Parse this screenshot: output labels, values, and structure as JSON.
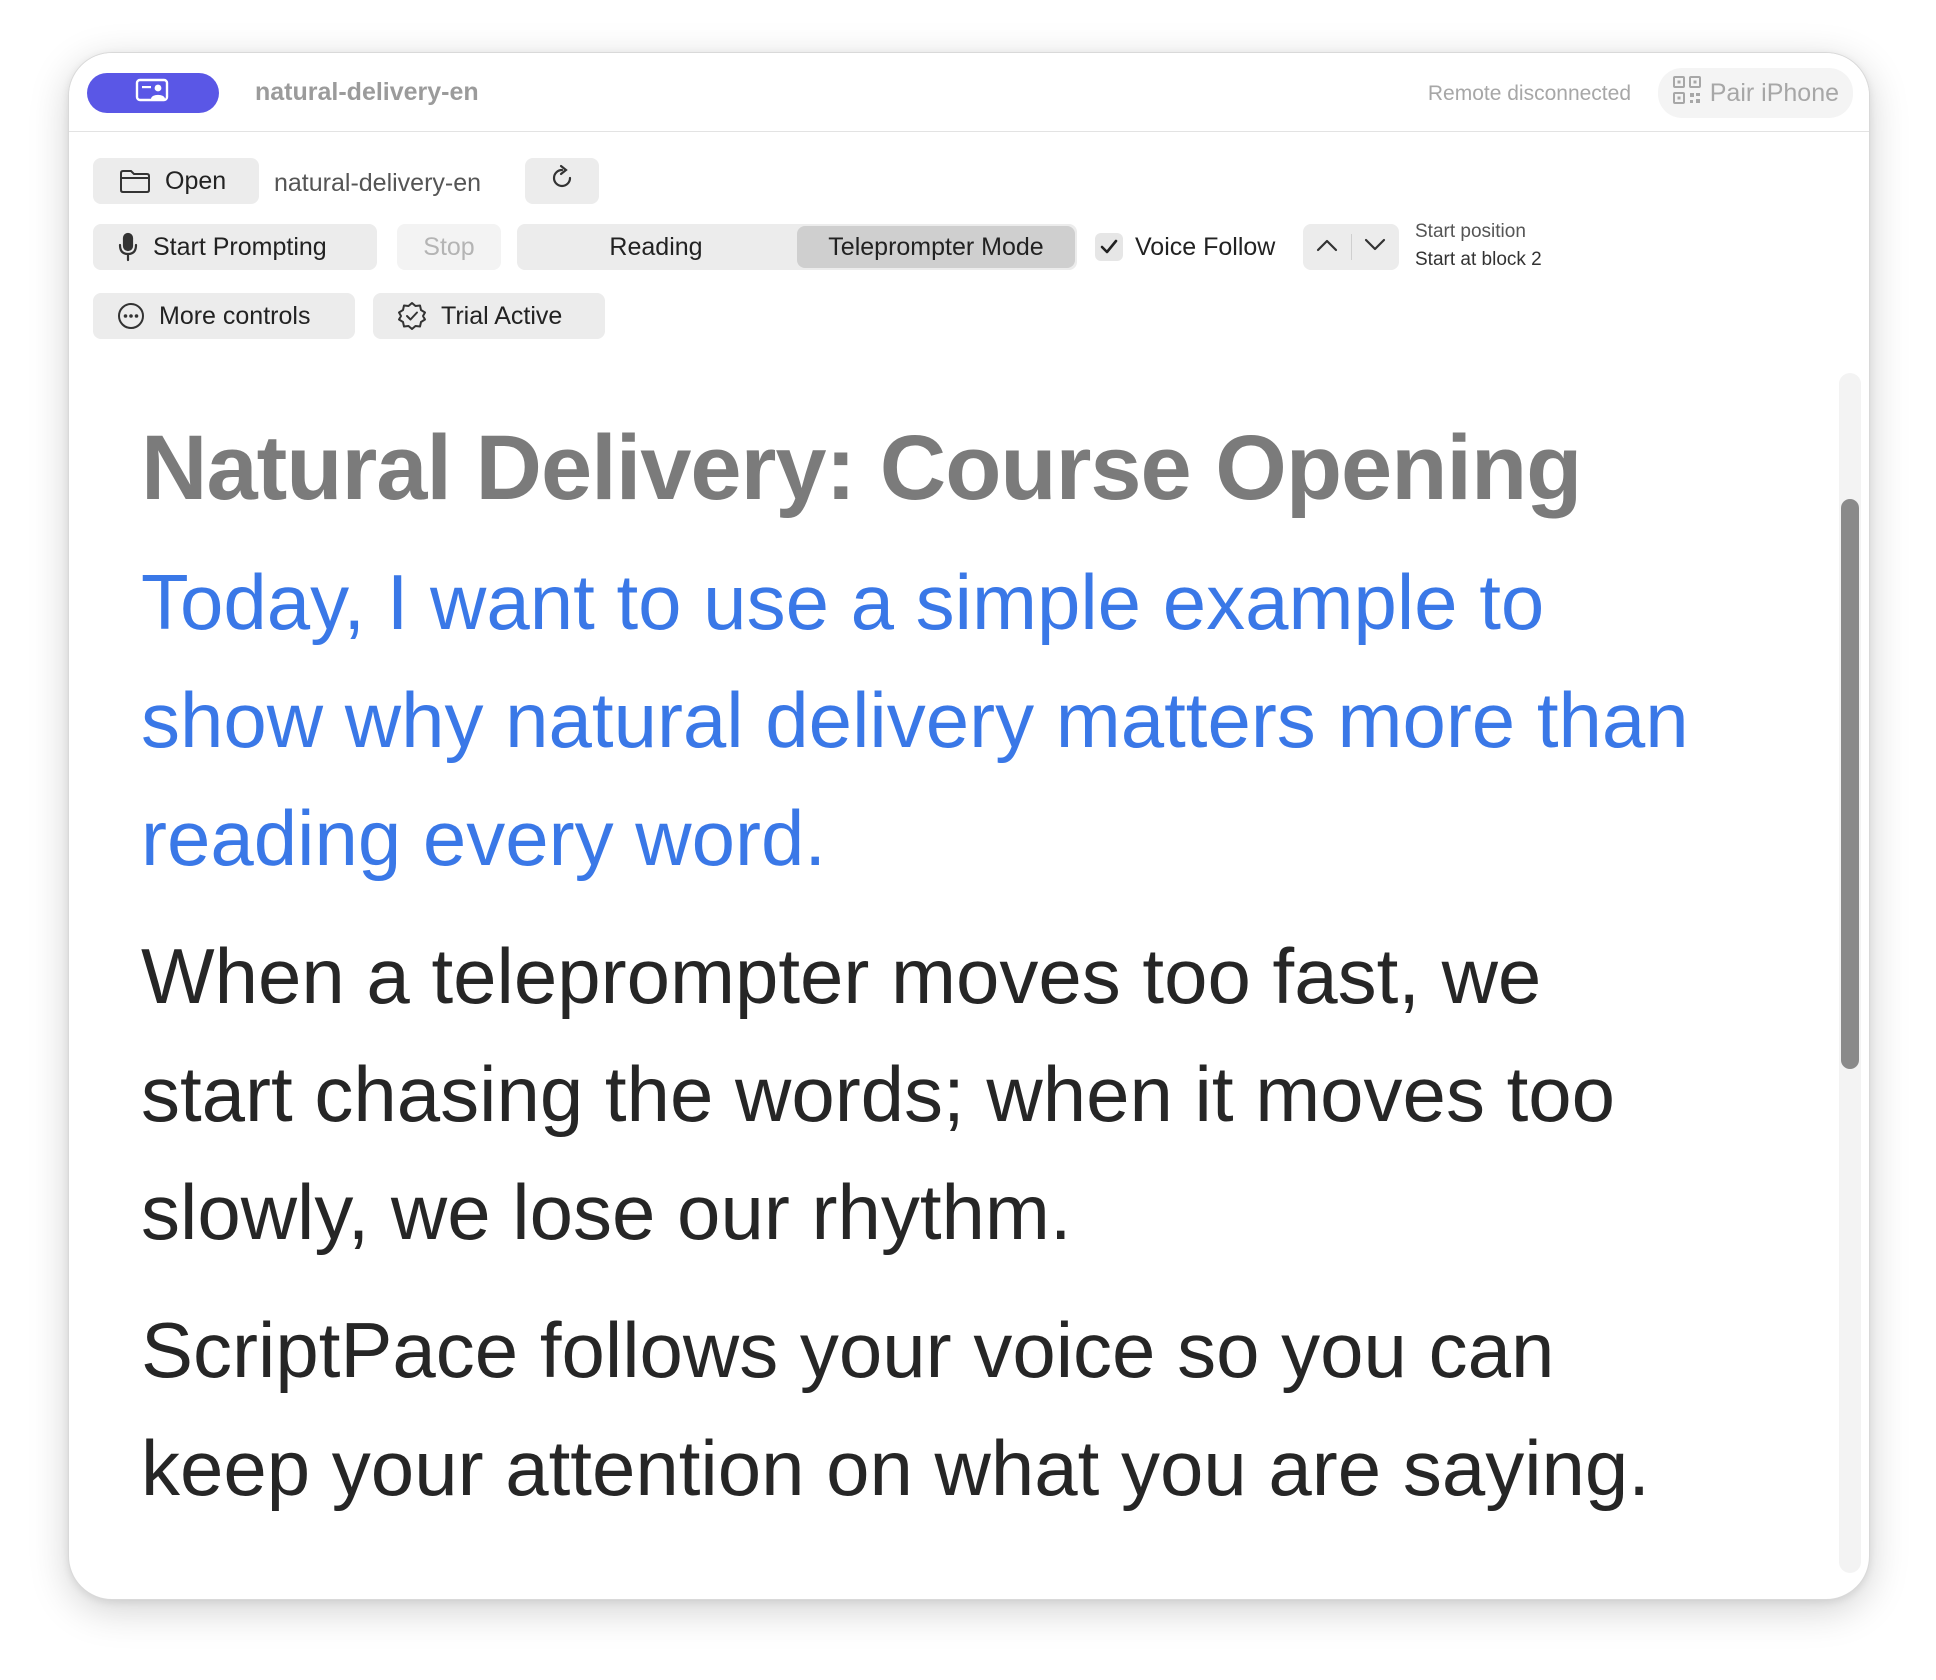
{
  "window": {
    "title": "natural-delivery-en",
    "remote_status": "Remote disconnected",
    "pair_label": "Pair iPhone",
    "accent": "#5a57e6"
  },
  "toolbar": {
    "open_label": "Open",
    "file_name": "natural-delivery-en",
    "start_label": "Start Prompting",
    "stop_label": "Stop",
    "modes": [
      "Reading",
      "Teleprompter Mode"
    ],
    "active_mode": "Teleprompter Mode",
    "voice_follow_label": "Voice Follow",
    "voice_follow_checked": true,
    "start_position_label": "Start position",
    "start_position_value": "Start at block 2",
    "more_label": "More controls",
    "trial_label": "Trial Active"
  },
  "icons": {
    "app": "screen-person-icon",
    "pair": "qr-code-icon",
    "open": "folder-icon",
    "reload": "reload-icon",
    "mic": "microphone-icon",
    "more": "ellipsis-circle-icon",
    "trial": "checkmark-seal-icon"
  },
  "script": {
    "title": "Natural Delivery: Course Opening",
    "current_color": "#3a78e7",
    "blocks": [
      "Today, I want to use a simple example to show why natural delivery matters more than reading every word.",
      "When a teleprompter moves too fast, we start chasing the words; when it moves too slowly, we lose our rhythm.",
      "ScriptPace follows your voice so you can keep your attention on what you are saying."
    ]
  }
}
